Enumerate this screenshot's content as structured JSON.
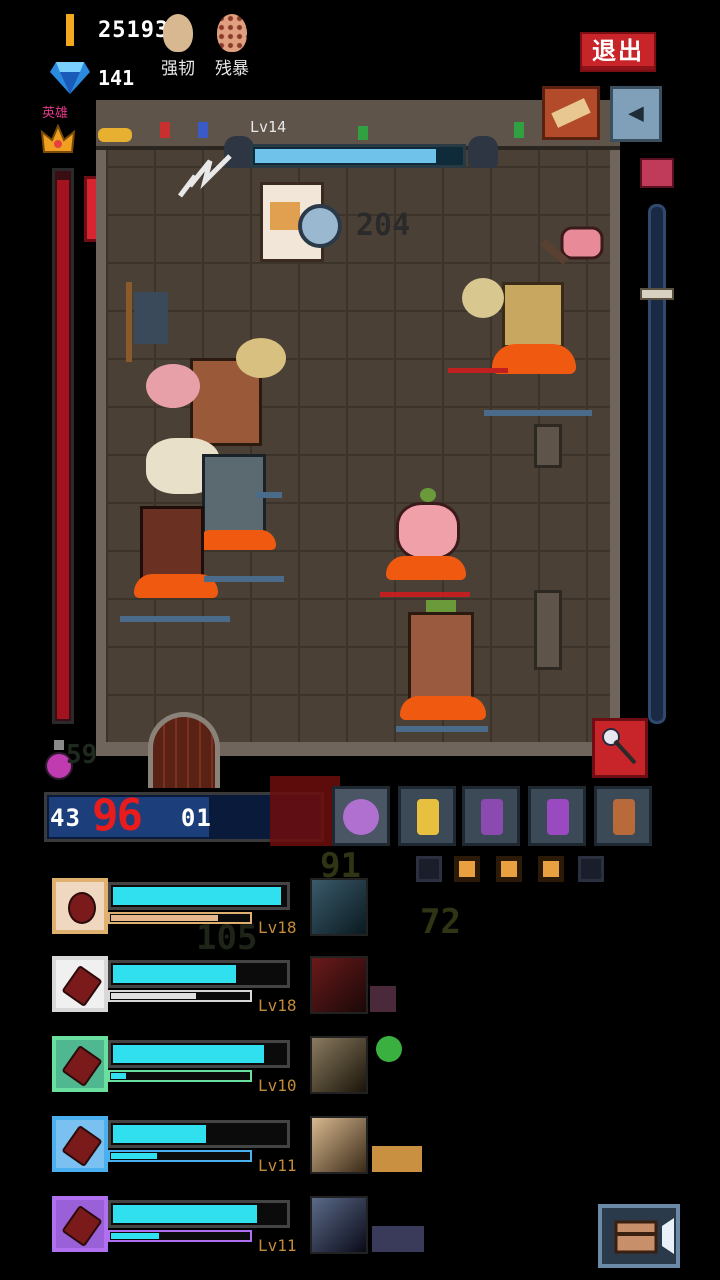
{
  "top": {
    "gold": "25193",
    "gems": "141",
    "buffs": [
      {
        "label": "强韧",
        "icon": "stacked-egg-icon",
        "color": "#d8b890"
      },
      {
        "label": "残暴",
        "icon": "spotted-egg-icon",
        "color": "#e0a080"
      }
    ],
    "exit_label": "退出"
  },
  "hero": {
    "label": "英雄",
    "gauge_fill": 0.98
  },
  "boss": {
    "level": "Lv14",
    "hp_fraction": 0.88,
    "damage_text": "204"
  },
  "potion": {
    "count": "59"
  },
  "player": {
    "hp_text": "43",
    "hp_suffix": "01",
    "damage_text": "96",
    "hp_fraction": 0.6
  },
  "weapons": [
    {
      "name": "purple-orb-icon"
    },
    {
      "name": "sword-icon"
    },
    {
      "name": "crossbow-icon"
    },
    {
      "name": "purple-hammer-icon"
    },
    {
      "name": "bow-icon"
    }
  ],
  "wave_dots": [
    false,
    true,
    true,
    true,
    false
  ],
  "floating_damage": [
    "91",
    "72",
    "105"
  ],
  "skills": [
    {
      "level": "Lv18",
      "icon": "red-gem-icon",
      "border": "#e0b070",
      "bg": "#f0d8c0",
      "fill": 0.98,
      "sub_fill": 0.78,
      "sub_color": "#e6b890"
    },
    {
      "level": "Lv18",
      "icon": "spear-icon",
      "border": "#d8d8d8",
      "bg": "#f0f0f0",
      "fill": 0.72,
      "sub_fill": 0.62,
      "sub_color": "#e0e0e0"
    },
    {
      "level": "Lv10",
      "icon": "crossed-axes-icon",
      "border": "#6ae0a0",
      "bg": "#50b890",
      "fill": 0.88,
      "sub_fill": 0.12,
      "sub_color": "#30e0ee"
    },
    {
      "level": "Lv11",
      "icon": "winged-axe-icon",
      "border": "#4ab0f0",
      "bg": "#7ac0f0",
      "fill": 0.55,
      "sub_fill": 0.34,
      "sub_color": "#30e0ee"
    },
    {
      "level": "Lv11",
      "icon": "trident-icon",
      "border": "#b070f0",
      "bg": "#9a60d8",
      "fill": 0.84,
      "sub_fill": 0.36,
      "sub_color": "#30e0ee"
    }
  ]
}
